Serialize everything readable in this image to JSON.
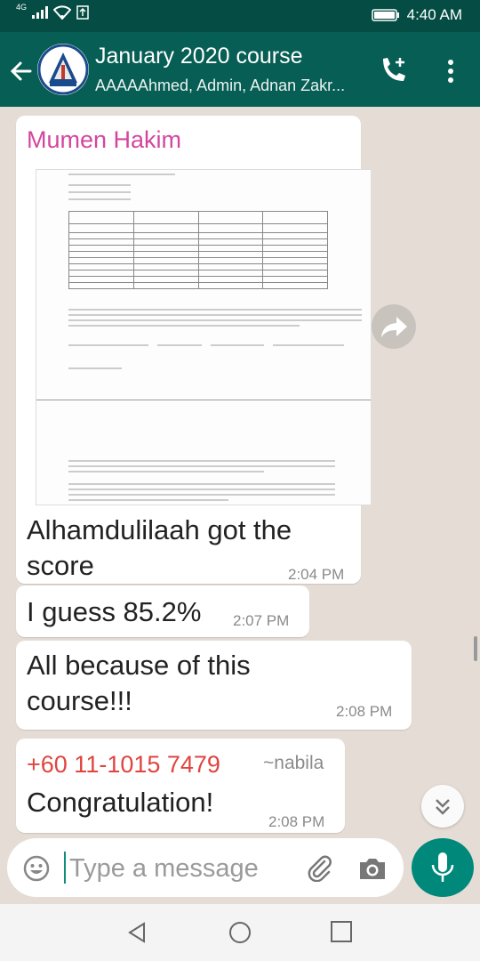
{
  "status_bar": {
    "network": "4G",
    "time": "4:40 AM"
  },
  "header": {
    "title": "January 2020 course",
    "subtitle": "AAAAAhmed, Admin, Adnan Zakr..."
  },
  "messages": [
    {
      "sender": "Mumen Hakim",
      "text": "Alhamdulilaah got the score",
      "time": "2:04 PM"
    },
    {
      "text": "I guess 85.2%",
      "time": "2:07 PM"
    },
    {
      "text": "All because of this course!!!",
      "time": "2:08 PM"
    },
    {
      "sender": "+60 11-1015 7479",
      "alias": "~nabila",
      "text": "Congratulation!",
      "time": "2:08 PM"
    }
  ],
  "composer": {
    "placeholder": "Type a message"
  },
  "colors": {
    "header": "#075e54",
    "status": "#054d44",
    "accent": "#00897b",
    "chat_bg": "#e5ddd5"
  },
  "icons": [
    "back-arrow-icon",
    "group-avatar",
    "add-call-icon",
    "more-icon",
    "forward-icon",
    "scroll-down-icon",
    "emoji-icon",
    "attach-icon",
    "camera-icon",
    "mic-icon",
    "nav-back-icon",
    "nav-home-icon",
    "nav-recent-icon"
  ]
}
